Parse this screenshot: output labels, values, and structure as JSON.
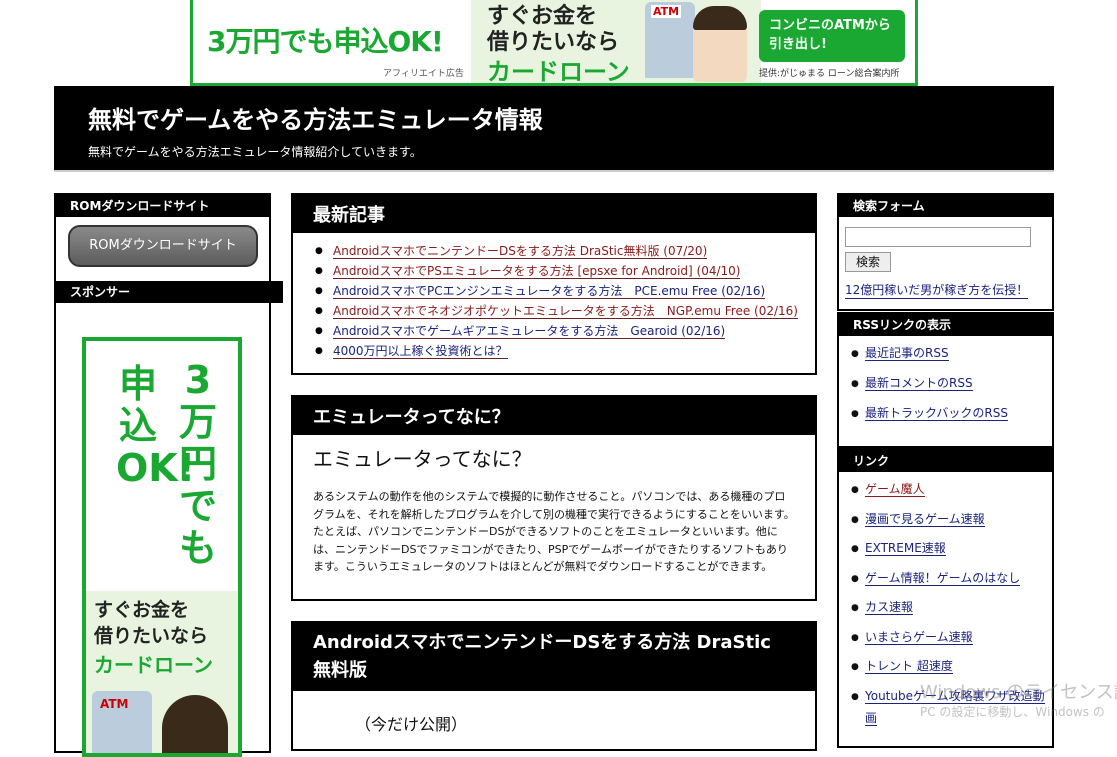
{
  "top_banner": {
    "headline": "3万円でも申込OK!",
    "affiliate_note": "アフィリエイト広告",
    "line1": "すぐお金を",
    "line2": "借りたいなら",
    "line3": "カードローン",
    "atm_label": "ATM",
    "bubble_line1": "コンビニのATMから",
    "bubble_line2": "引き出し!",
    "provider": "提供:がじゅまる ローン総合案内所"
  },
  "header": {
    "title": "無料でゲームをやる方法エミュレータ情報",
    "subtitle": "無料でゲームをやる方法エミュレータ情報紹介していきます。"
  },
  "left": {
    "rom_heading": "ROMダウンロードサイト",
    "rom_button": "ROMダウンロードサイト",
    "sponsor_heading": "スポンサー",
    "ad_col1": "3万円でも",
    "ad_col2": "申込OK!",
    "ad_line1": "すぐお金を",
    "ad_line2": "借りたいなら",
    "ad_line3": "カードローン",
    "ad_atm": "ATM"
  },
  "recent": {
    "heading": "最新記事",
    "items": [
      "AndroidスマホでニンテンドーDSをする方法 DraStic無料版 (07/20)",
      "AndroidスマホでPSエミュレータをする方法 [epsxe for Android] (04/10)",
      "AndroidスマホでPCエンジンエミュレータをする方法　PCE.emu Free (02/16)",
      "Androidスマホでネオジオポケットエミュレータをする方法　NGP.emu Free (02/16)",
      "Androidスマホでゲームギアエミュレータをする方法　Gearoid (02/16)",
      "4000万円以上稼ぐ投資術とは？"
    ]
  },
  "emu": {
    "heading": "エミュレータってなに？",
    "subheading": "エミュレータってなに？",
    "body": "あるシステムの動作を他のシステムで模擬的に動作させること。パソコンでは、ある機種のプログラムを、それを解析したプログラムを介して別の機種で実行できるようにすることをいいます。たとえば、パソコンでニンテンドーDSができるソフトのことをエミュレータといいます。他には、ニンテンドーDSでファミコンができたり、PSPでゲームボーイができたりするソフトもあります。こういうエミュレータのソフトはほとんどが無料でダウンロードすることができます。"
  },
  "post": {
    "heading": "AndroidスマホでニンテンドーDSをする方法 DraStic 無料版",
    "excerpt": "（今だけ公開）"
  },
  "search": {
    "heading": "検索フォーム",
    "button": "検索",
    "promo": "12億円稼いだ男が稼ぎ方を伝授！"
  },
  "rss": {
    "heading": "RSSリンクの表示",
    "items": [
      "最近記事のRSS",
      "最新コメントのRSS",
      "最新トラックバックのRSS"
    ]
  },
  "links": {
    "heading": "リンク",
    "items": [
      "ゲーム魔人",
      "漫画で見るゲーム速報",
      "EXTREME速報",
      "ゲーム情報！ゲームのはなし",
      "カス速報",
      "いまさらゲーム速報",
      "トレント 超速度",
      "Youtubeゲーム攻略裏ワザ改造動画"
    ]
  },
  "watermark": {
    "line1": "Windows のライセンス認",
    "line2": "PC の設定に移動し、Windows の"
  }
}
